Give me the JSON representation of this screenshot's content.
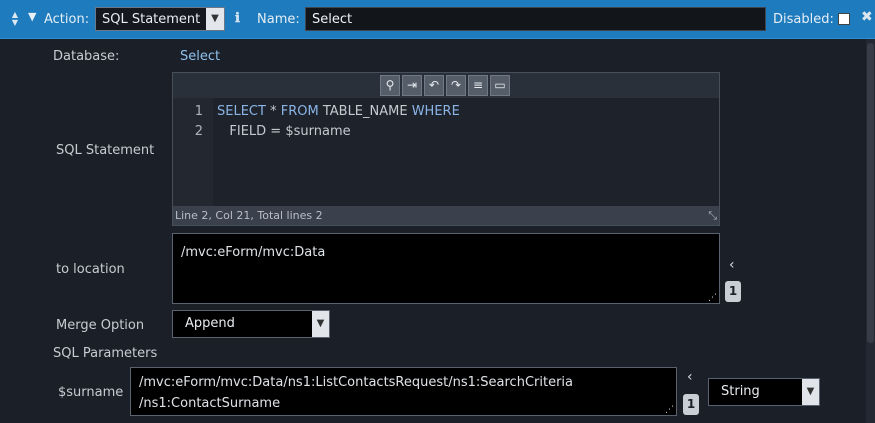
{
  "header": {
    "action_label": "Action:",
    "action_value": "SQL Statement",
    "name_label": "Name:",
    "name_value": "Select",
    "disabled_label": "Disabled:",
    "info_icon": "ℹ"
  },
  "database": {
    "label": "Database:",
    "value": "Select"
  },
  "sql_statement": {
    "label": "SQL Statement",
    "toolbar_icons": [
      "search-icon",
      "login-icon",
      "undo-icon",
      "redo-icon",
      "format-icon",
      "fullscreen-icon"
    ],
    "lines": [
      {
        "num": "1",
        "kw1": "SELECT",
        "mid": " * ",
        "kw2": "FROM",
        "mid2": " TABLE_NAME ",
        "kw3": "WHERE"
      },
      {
        "num": "2",
        "text": "   FIELD = $surname"
      }
    ],
    "status": "Line 2, Col 21, Total lines 2"
  },
  "to_location": {
    "label": "to location",
    "value": "/mvc:eForm/mvc:Data",
    "badge": "1"
  },
  "merge_option": {
    "label": "Merge Option",
    "value": "Append"
  },
  "sql_parameters": {
    "label": "SQL Parameters",
    "params": [
      {
        "name": "$surname",
        "value_line1": "/mvc:eForm/mvc:Data/ns1:ListContactsRequest/ns1:SearchCriteria",
        "value_line2": "/ns1:ContactSurname",
        "badge": "1",
        "type": "String"
      }
    ]
  }
}
